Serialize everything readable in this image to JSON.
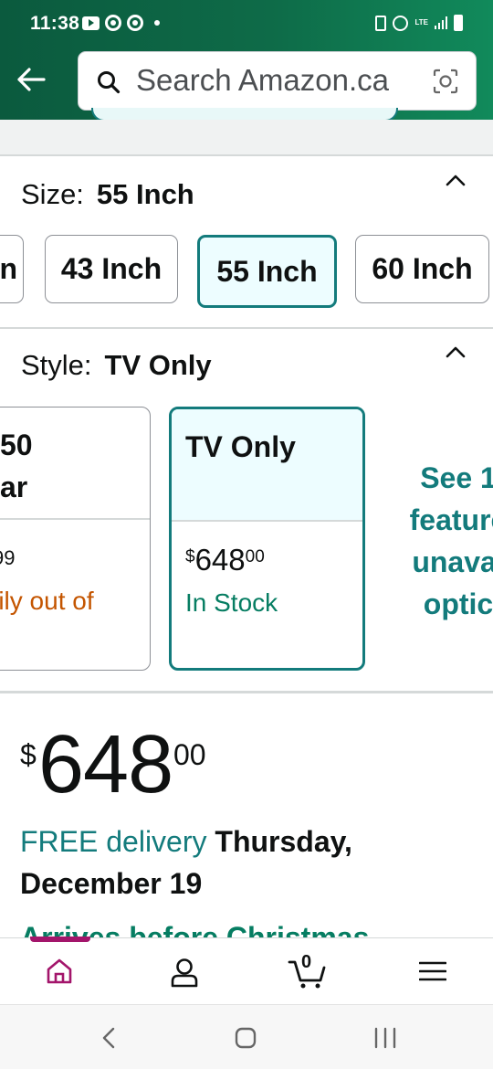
{
  "status_bar": {
    "time": "11:38",
    "network": "LTE"
  },
  "search": {
    "placeholder": "Search Amazon.ca"
  },
  "size": {
    "label": "Size:",
    "selected": "55 Inch",
    "options": [
      "n",
      "43 Inch",
      "55 Inch",
      "60 Inch"
    ]
  },
  "style": {
    "label": "Style:",
    "selected": "TV Only",
    "cards": [
      {
        "name_line1": "50",
        "name_line2": "ar",
        "price": "99",
        "availability": "rily out of"
      },
      {
        "name": "TV Only",
        "currency": "$",
        "price_whole": "648",
        "price_fraction": "00",
        "availability": "In Stock"
      }
    ],
    "see_more": [
      "See 1",
      "feature",
      "unavai",
      "optic"
    ]
  },
  "price": {
    "currency": "$",
    "whole": "648",
    "fraction": "00"
  },
  "delivery": {
    "free_label": "FREE delivery",
    "date_line1": "Thursday,",
    "date_line2": "December 19"
  },
  "arrives": "Arrives before Christmas",
  "bottom_nav": {
    "cart_count": "0",
    "active": "home"
  },
  "colors": {
    "teal": "#137b7c",
    "header_green": "#0e6b48",
    "in_stock": "#067d62",
    "warning": "#c45500",
    "active_nav": "#a3156b"
  }
}
